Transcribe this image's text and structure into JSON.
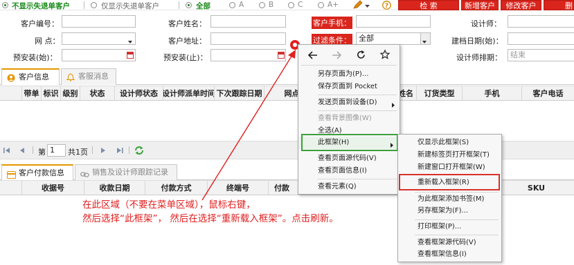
{
  "filter_bar": {
    "opt1": "不显示失退单客户",
    "opt2": "仅显示失退单客户",
    "status_all": "全部",
    "status_a": "A",
    "status_b": "B",
    "status_c": "C",
    "status_aplus": "A+",
    "search_btn": "检 索",
    "add_btn": "新增客户",
    "edit_btn": "修改客户",
    "del_btn": "删"
  },
  "form": {
    "customer_no": "客户编号：",
    "customer_name": "客户姓名：",
    "customer_phone": "客户手机：",
    "designer": "设计师：",
    "site": "网 点：",
    "customer_addr": "客户地址：",
    "filter_cond": "过滤条件：",
    "filter_value": "全部",
    "build_date_start": "建档日期(始)：",
    "preinstall_start": "预安装(始)：",
    "preinstall_end": "预安装(止)：",
    "designer_schedule": "设计师排期：",
    "end_placeholder": "结束"
  },
  "tabs_top": {
    "tab1": "客户信息",
    "tab2": "客服消息"
  },
  "table_top": {
    "headers": [
      "带单",
      "标识",
      "级别",
      "状态",
      "设计师状态",
      "设计师派单时间",
      "下次跟踪日期",
      "网点",
      "姓名",
      "订货类型",
      "手机",
      "客户电话"
    ]
  },
  "pager": {
    "page_prefix": "第",
    "page_value": "1",
    "page_total": "共1页"
  },
  "tabs_bottom": {
    "tab1": "客户付款信息",
    "tab2": "销售及设计师跟踪记录"
  },
  "table_bottom": {
    "headers": [
      "收据号",
      "收款日期",
      "付款方式",
      "终端号",
      "付款",
      "SKU"
    ]
  },
  "context_menu": {
    "items": [
      "另存页面为(P)...",
      "保存页面到 Pocket",
      "发送页面到设备(D)",
      "查看背景图像(W)",
      "全选(A)",
      "此框架(H)",
      "查看页面源代码(V)",
      "查看页面信息(I)",
      "查看元素(Q)"
    ]
  },
  "submenu": {
    "items": [
      "仅显示此框架(S)",
      "新建标签页打开框架(T)",
      "新建窗口打开框架(W)",
      "重新载入框架(R)",
      "为此框架添加书签(M)",
      "另存框架为(F)...",
      "打印框架(P)...",
      "查看框架源代码(V)",
      "查看框架信息(I)"
    ]
  },
  "annotation": {
    "line1": "在此区域（不要在菜单区域），鼠标右键，",
    "line2": "然后选择“此框架”， 然后在选择“重新载入框架”。点击刷新。"
  },
  "colors": {
    "accent_red": "#d9251c",
    "annotation_red": "#e02020",
    "tab_orange": "#e49600",
    "menu_green": "#3aa03a"
  }
}
